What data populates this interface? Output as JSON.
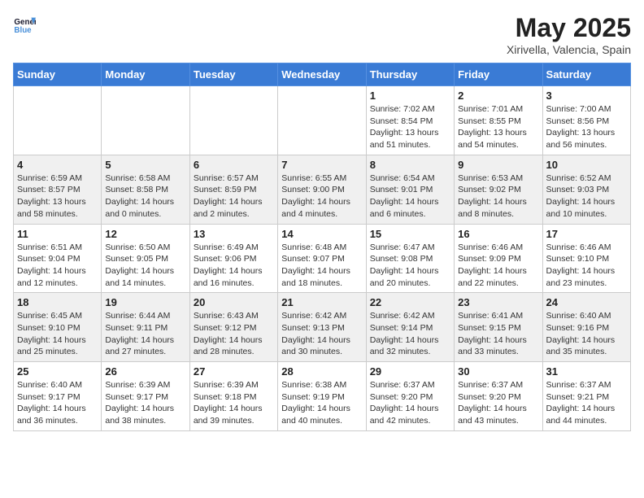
{
  "header": {
    "logo_line1": "General",
    "logo_line2": "Blue",
    "month_title": "May 2025",
    "location": "Xirivella, Valencia, Spain"
  },
  "days_of_week": [
    "Sunday",
    "Monday",
    "Tuesday",
    "Wednesday",
    "Thursday",
    "Friday",
    "Saturday"
  ],
  "weeks": [
    [
      {
        "day": "",
        "info": ""
      },
      {
        "day": "",
        "info": ""
      },
      {
        "day": "",
        "info": ""
      },
      {
        "day": "",
        "info": ""
      },
      {
        "day": "1",
        "info": "Sunrise: 7:02 AM\nSunset: 8:54 PM\nDaylight: 13 hours\nand 51 minutes."
      },
      {
        "day": "2",
        "info": "Sunrise: 7:01 AM\nSunset: 8:55 PM\nDaylight: 13 hours\nand 54 minutes."
      },
      {
        "day": "3",
        "info": "Sunrise: 7:00 AM\nSunset: 8:56 PM\nDaylight: 13 hours\nand 56 minutes."
      }
    ],
    [
      {
        "day": "4",
        "info": "Sunrise: 6:59 AM\nSunset: 8:57 PM\nDaylight: 13 hours\nand 58 minutes."
      },
      {
        "day": "5",
        "info": "Sunrise: 6:58 AM\nSunset: 8:58 PM\nDaylight: 14 hours\nand 0 minutes."
      },
      {
        "day": "6",
        "info": "Sunrise: 6:57 AM\nSunset: 8:59 PM\nDaylight: 14 hours\nand 2 minutes."
      },
      {
        "day": "7",
        "info": "Sunrise: 6:55 AM\nSunset: 9:00 PM\nDaylight: 14 hours\nand 4 minutes."
      },
      {
        "day": "8",
        "info": "Sunrise: 6:54 AM\nSunset: 9:01 PM\nDaylight: 14 hours\nand 6 minutes."
      },
      {
        "day": "9",
        "info": "Sunrise: 6:53 AM\nSunset: 9:02 PM\nDaylight: 14 hours\nand 8 minutes."
      },
      {
        "day": "10",
        "info": "Sunrise: 6:52 AM\nSunset: 9:03 PM\nDaylight: 14 hours\nand 10 minutes."
      }
    ],
    [
      {
        "day": "11",
        "info": "Sunrise: 6:51 AM\nSunset: 9:04 PM\nDaylight: 14 hours\nand 12 minutes."
      },
      {
        "day": "12",
        "info": "Sunrise: 6:50 AM\nSunset: 9:05 PM\nDaylight: 14 hours\nand 14 minutes."
      },
      {
        "day": "13",
        "info": "Sunrise: 6:49 AM\nSunset: 9:06 PM\nDaylight: 14 hours\nand 16 minutes."
      },
      {
        "day": "14",
        "info": "Sunrise: 6:48 AM\nSunset: 9:07 PM\nDaylight: 14 hours\nand 18 minutes."
      },
      {
        "day": "15",
        "info": "Sunrise: 6:47 AM\nSunset: 9:08 PM\nDaylight: 14 hours\nand 20 minutes."
      },
      {
        "day": "16",
        "info": "Sunrise: 6:46 AM\nSunset: 9:09 PM\nDaylight: 14 hours\nand 22 minutes."
      },
      {
        "day": "17",
        "info": "Sunrise: 6:46 AM\nSunset: 9:10 PM\nDaylight: 14 hours\nand 23 minutes."
      }
    ],
    [
      {
        "day": "18",
        "info": "Sunrise: 6:45 AM\nSunset: 9:10 PM\nDaylight: 14 hours\nand 25 minutes."
      },
      {
        "day": "19",
        "info": "Sunrise: 6:44 AM\nSunset: 9:11 PM\nDaylight: 14 hours\nand 27 minutes."
      },
      {
        "day": "20",
        "info": "Sunrise: 6:43 AM\nSunset: 9:12 PM\nDaylight: 14 hours\nand 28 minutes."
      },
      {
        "day": "21",
        "info": "Sunrise: 6:42 AM\nSunset: 9:13 PM\nDaylight: 14 hours\nand 30 minutes."
      },
      {
        "day": "22",
        "info": "Sunrise: 6:42 AM\nSunset: 9:14 PM\nDaylight: 14 hours\nand 32 minutes."
      },
      {
        "day": "23",
        "info": "Sunrise: 6:41 AM\nSunset: 9:15 PM\nDaylight: 14 hours\nand 33 minutes."
      },
      {
        "day": "24",
        "info": "Sunrise: 6:40 AM\nSunset: 9:16 PM\nDaylight: 14 hours\nand 35 minutes."
      }
    ],
    [
      {
        "day": "25",
        "info": "Sunrise: 6:40 AM\nSunset: 9:17 PM\nDaylight: 14 hours\nand 36 minutes."
      },
      {
        "day": "26",
        "info": "Sunrise: 6:39 AM\nSunset: 9:17 PM\nDaylight: 14 hours\nand 38 minutes."
      },
      {
        "day": "27",
        "info": "Sunrise: 6:39 AM\nSunset: 9:18 PM\nDaylight: 14 hours\nand 39 minutes."
      },
      {
        "day": "28",
        "info": "Sunrise: 6:38 AM\nSunset: 9:19 PM\nDaylight: 14 hours\nand 40 minutes."
      },
      {
        "day": "29",
        "info": "Sunrise: 6:37 AM\nSunset: 9:20 PM\nDaylight: 14 hours\nand 42 minutes."
      },
      {
        "day": "30",
        "info": "Sunrise: 6:37 AM\nSunset: 9:20 PM\nDaylight: 14 hours\nand 43 minutes."
      },
      {
        "day": "31",
        "info": "Sunrise: 6:37 AM\nSunset: 9:21 PM\nDaylight: 14 hours\nand 44 minutes."
      }
    ]
  ]
}
